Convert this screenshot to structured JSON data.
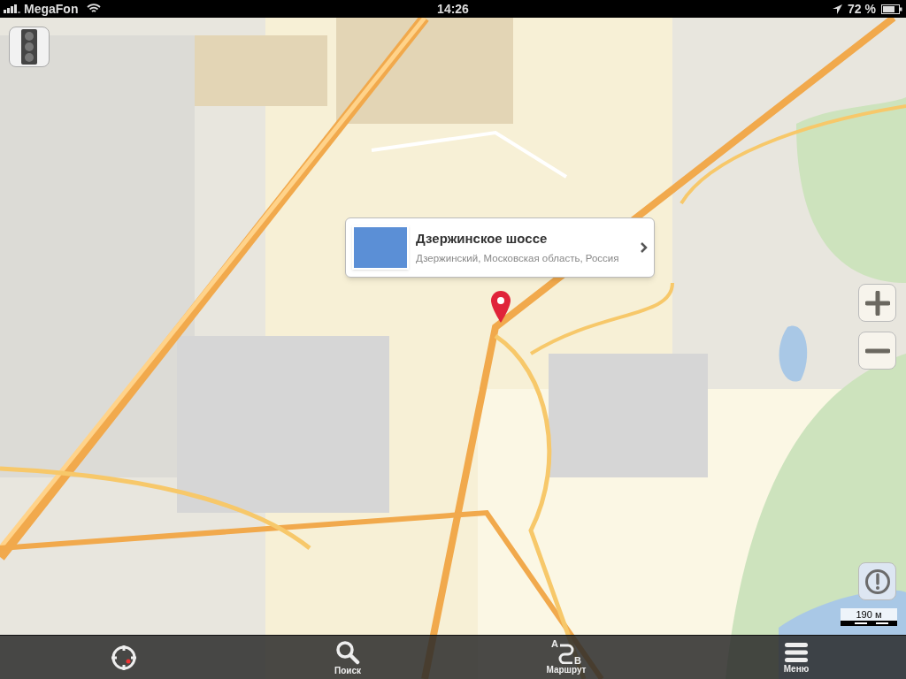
{
  "status_bar": {
    "carrier": "MegaFon",
    "time": "14:26",
    "battery": "72 %"
  },
  "popup": {
    "title": "Дзержинское шоссе",
    "subtitle": "Дзержинский, Московская область, Россия"
  },
  "scale": {
    "label": "190 м"
  },
  "toolbar": [
    {
      "kind": "locate"
    },
    {
      "kind": "search",
      "label": "Поиск"
    },
    {
      "kind": "route",
      "label": "Маршрут",
      "letters": [
        "A",
        "B"
      ]
    },
    {
      "kind": "menu",
      "label": "Меню"
    }
  ]
}
